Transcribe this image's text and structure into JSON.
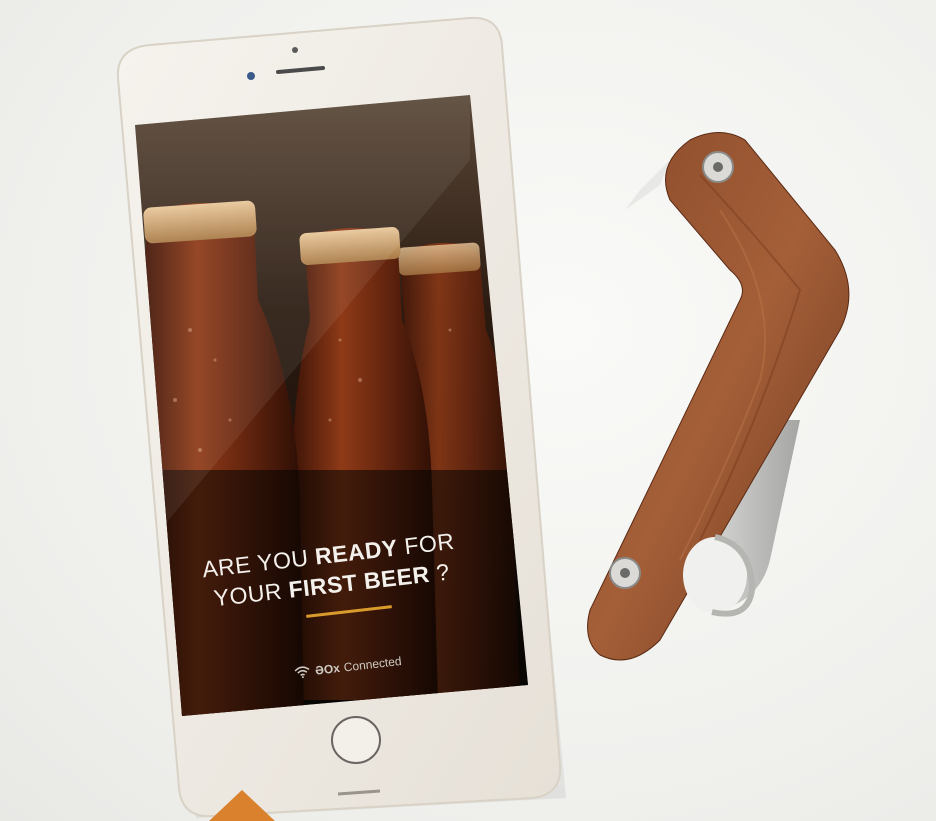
{
  "screen": {
    "headline_line1_a": "ARE YOU",
    "headline_line1_b": "READY",
    "headline_line1_c": "FOR",
    "headline_line2_a": "YOUR",
    "headline_line2_b": "FIRST BEER",
    "headline_line2_c": "?",
    "status_text": "Connected",
    "status_logo": "ƏOx",
    "status_icon": "wifi-icon"
  },
  "colors": {
    "accent_underline": "#d99b2b",
    "marker": "#d9812c"
  }
}
